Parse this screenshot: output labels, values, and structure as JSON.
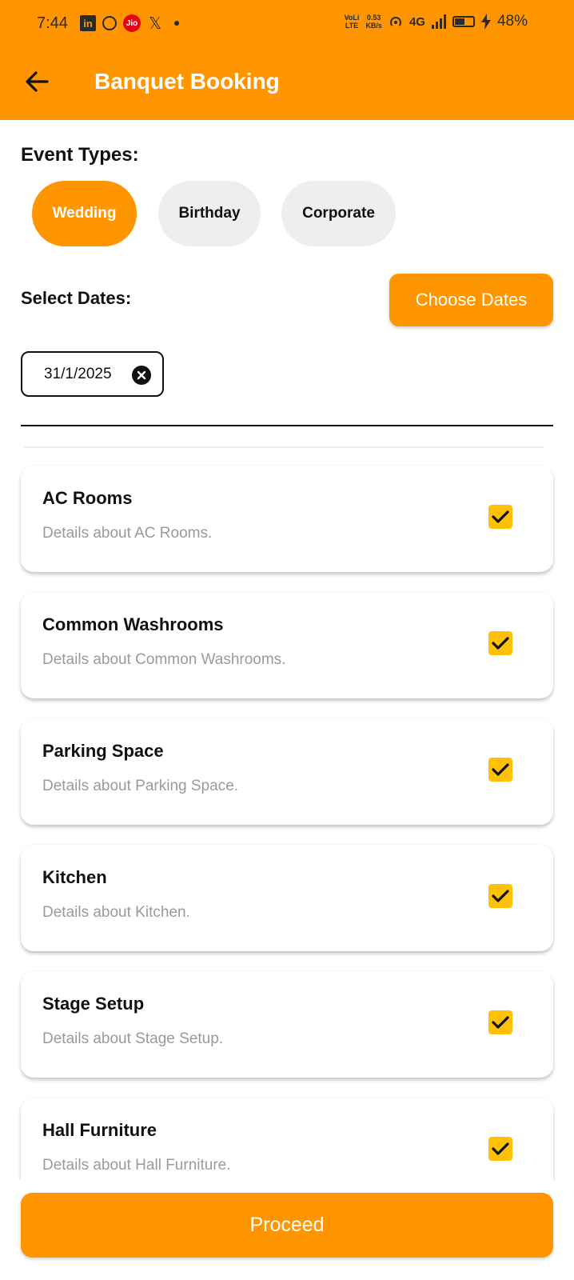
{
  "status_bar": {
    "time": "7:44",
    "jio_label": "Jio",
    "volte_top": "VoLi",
    "volte_bottom": "LTE",
    "speed_value": "0.53",
    "speed_unit": "KB/s",
    "network": "4G",
    "battery": "48%"
  },
  "header": {
    "title": "Banquet Booking",
    "back_icon": "arrow-left-icon"
  },
  "event_types": {
    "label": "Event Types:",
    "options": [
      {
        "label": "Wedding",
        "selected": true
      },
      {
        "label": "Birthday",
        "selected": false
      },
      {
        "label": "Corporate",
        "selected": false
      }
    ]
  },
  "dates": {
    "label": "Select Dates:",
    "choose_button": "Choose Dates",
    "selected": [
      "31/1/2025"
    ]
  },
  "amenities": [
    {
      "title": "AC Rooms",
      "details": "Details about AC Rooms.",
      "checked": true
    },
    {
      "title": "Common Washrooms",
      "details": "Details about Common Washrooms.",
      "checked": true
    },
    {
      "title": "Parking Space",
      "details": "Details about Parking Space.",
      "checked": true
    },
    {
      "title": "Kitchen",
      "details": "Details about Kitchen.",
      "checked": true
    },
    {
      "title": "Stage Setup",
      "details": "Details about Stage Setup.",
      "checked": true
    },
    {
      "title": "Hall Furniture",
      "details": "Details about Hall Furniture.",
      "checked": true
    }
  ],
  "proceed_button": "Proceed",
  "colors": {
    "accent": "#FF9500",
    "checkbox": "#FFC107",
    "chip_inactive": "#EEEEEE",
    "muted_text": "#9A9A9A"
  }
}
